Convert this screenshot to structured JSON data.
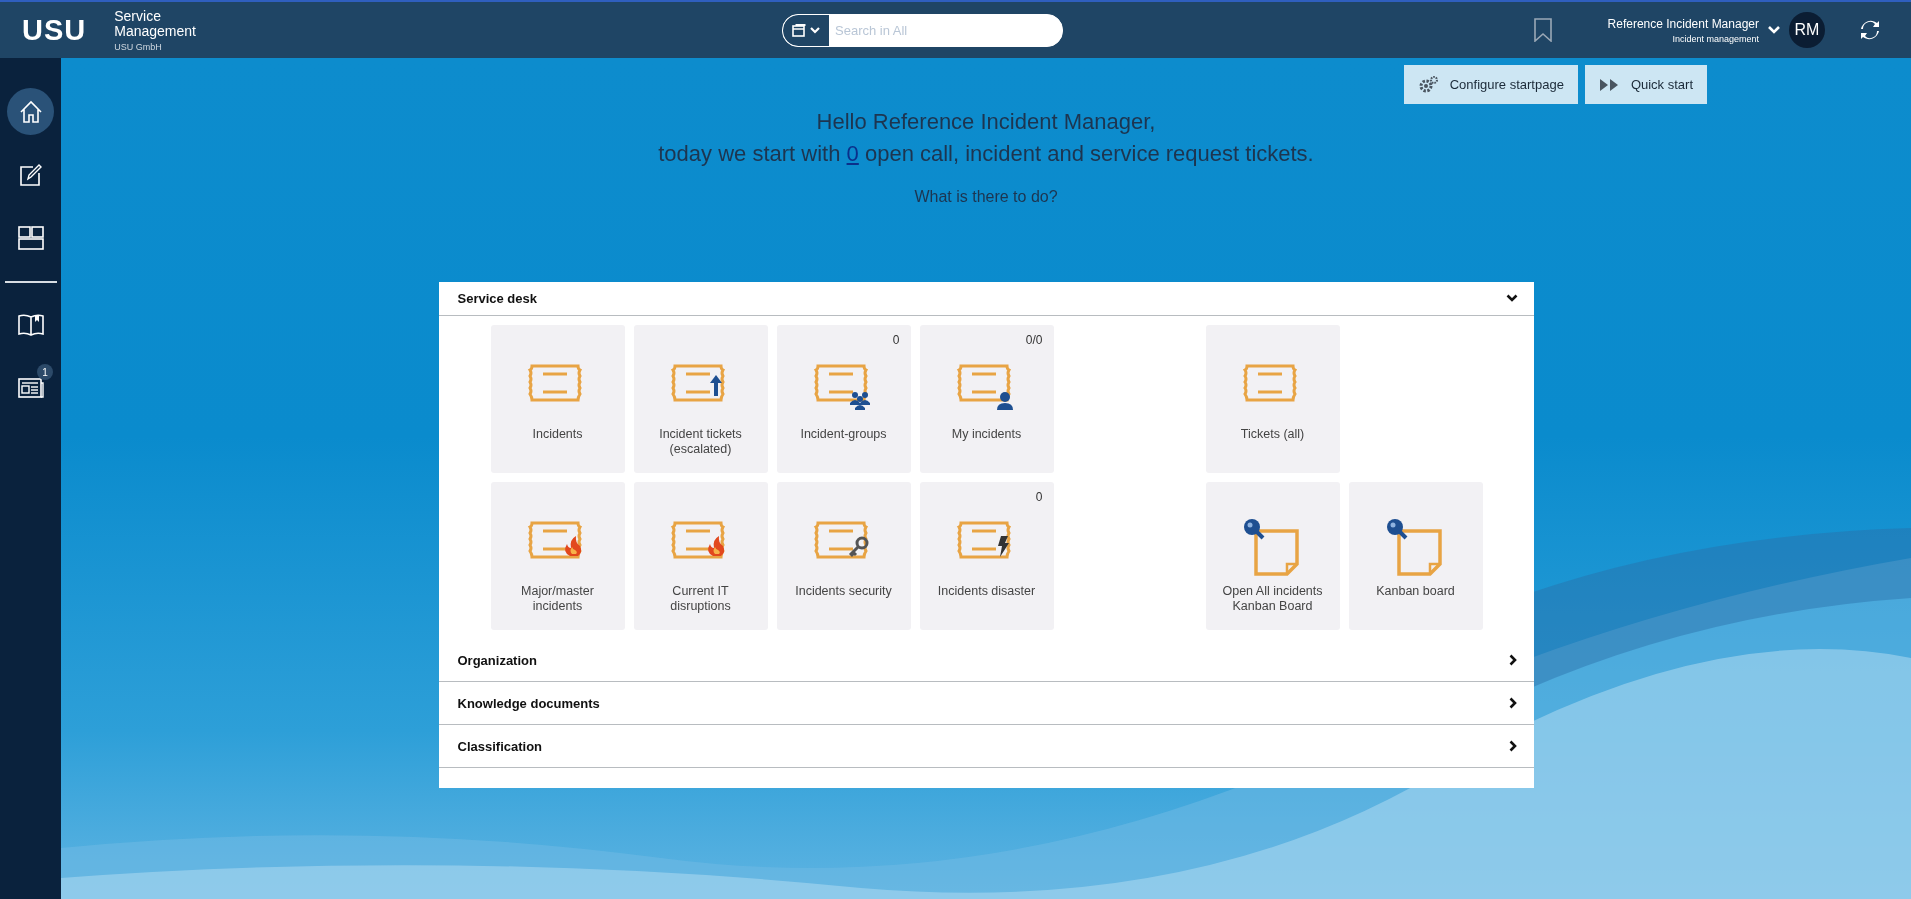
{
  "header": {
    "logo": "USU",
    "product": "Service Management",
    "company": "USU GmbH",
    "search": {
      "placeholder": "Search in All"
    },
    "user": {
      "name": "Reference Incident Manager",
      "role": "Incident management",
      "initials": "RM"
    }
  },
  "sidebar": {
    "items": [
      {
        "kind": "home",
        "selected": true
      },
      {
        "kind": "edit",
        "selected": false
      },
      {
        "kind": "dashboard",
        "selected": false
      }
    ],
    "lower_items": [
      {
        "kind": "book",
        "selected": false
      },
      {
        "kind": "news",
        "selected": false,
        "badge": "1"
      }
    ]
  },
  "toolbar": {
    "buttons": [
      {
        "kind": "gears",
        "label": "Configure startpage"
      },
      {
        "kind": "forward",
        "label": "Quick start"
      }
    ]
  },
  "greeting": {
    "title": "Hello Reference Incident Manager,",
    "before": "today we start with",
    "count": "0",
    "after": "open call, incident and service request tickets.",
    "question": "What is there to do?"
  },
  "sections": [
    {
      "title": "Service desk",
      "expanded": true,
      "tile_groups": [
        {
          "rows": [
            [
              {
                "label": "Incidents",
                "kind": "ticket"
              },
              {
                "label": "Incident tickets (escalated)",
                "kind": "ticket-up"
              },
              {
                "label": "Incident-groups",
                "kind": "ticket-group",
                "count": "0"
              },
              {
                "label": "My incidents",
                "kind": "ticket-user",
                "count": "0/0"
              }
            ],
            [
              {
                "label": "Major/master incidents",
                "kind": "ticket-fire"
              },
              {
                "label": "Current IT disruptions",
                "kind": "ticket-fire"
              },
              {
                "label": "Incidents security",
                "kind": "ticket-key"
              },
              {
                "label": "Incidents disaster",
                "kind": "ticket-bolt",
                "count": "0"
              }
            ]
          ]
        },
        {
          "rows": [
            [
              {
                "label": "Tickets (all)",
                "kind": "ticket"
              }
            ],
            [
              {
                "label": "Open All incidents Kanban Board",
                "kind": "note-search"
              },
              {
                "label": "Kanban board",
                "kind": "note-search"
              }
            ]
          ]
        }
      ]
    },
    {
      "title": "Organization",
      "expanded": false
    },
    {
      "title": "Knowledge documents",
      "expanded": false
    },
    {
      "title": "Classification",
      "expanded": false
    }
  ]
}
